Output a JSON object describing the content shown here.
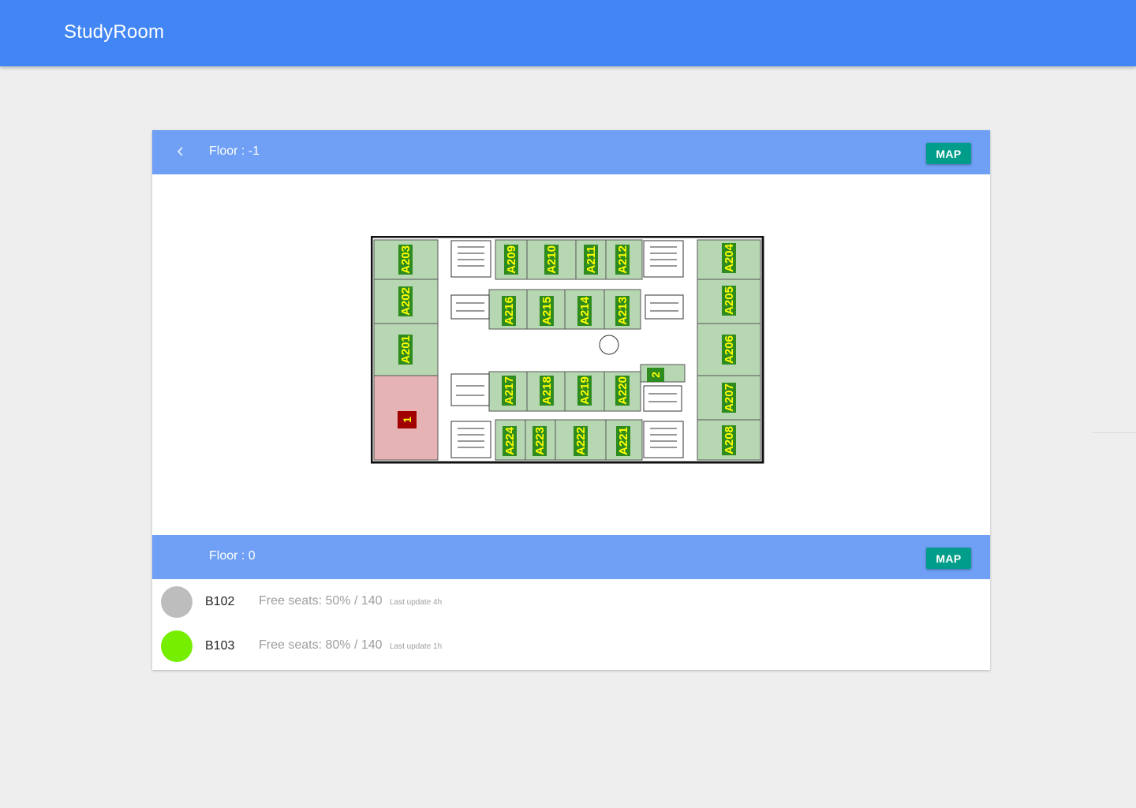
{
  "app": {
    "title": "StudyRoom"
  },
  "floors": [
    {
      "label": "Floor :  -1",
      "map_button": "MAP",
      "back_icon": "chevron-left-icon",
      "map": {
        "rooms_left": [
          "A203",
          "A202",
          "A201"
        ],
        "rooms_top": [
          "A209",
          "A210",
          "A211",
          "A212"
        ],
        "rooms_right": [
          "A204",
          "A205",
          "A206",
          "A207",
          "A208"
        ],
        "rooms_inner_top": [
          "A216",
          "A215",
          "A214",
          "A213"
        ],
        "rooms_inner_bottom": [
          "A217",
          "A218",
          "A219",
          "A220"
        ],
        "rooms_bottom": [
          "A224",
          "A223",
          "A222",
          "A221"
        ],
        "marker_1": "1",
        "marker_2": "2",
        "colors": {
          "room": "#b7d7b3",
          "label_bg": "#2e8b1e",
          "label_text": "#ffff00",
          "highlight": "#e5b3b3",
          "marker_bg": "#a00000"
        }
      }
    },
    {
      "label": "Floor :  0",
      "map_button": "MAP",
      "rooms": [
        {
          "name": "B102",
          "seats": "Free seats: 50% / 140",
          "updated": "Last update 4h",
          "status_color": "#bdbdbd"
        },
        {
          "name": "B103",
          "seats": "Free seats: 80% / 140",
          "updated": "Last update 1h",
          "status_color": "#76ee00"
        }
      ]
    }
  ]
}
